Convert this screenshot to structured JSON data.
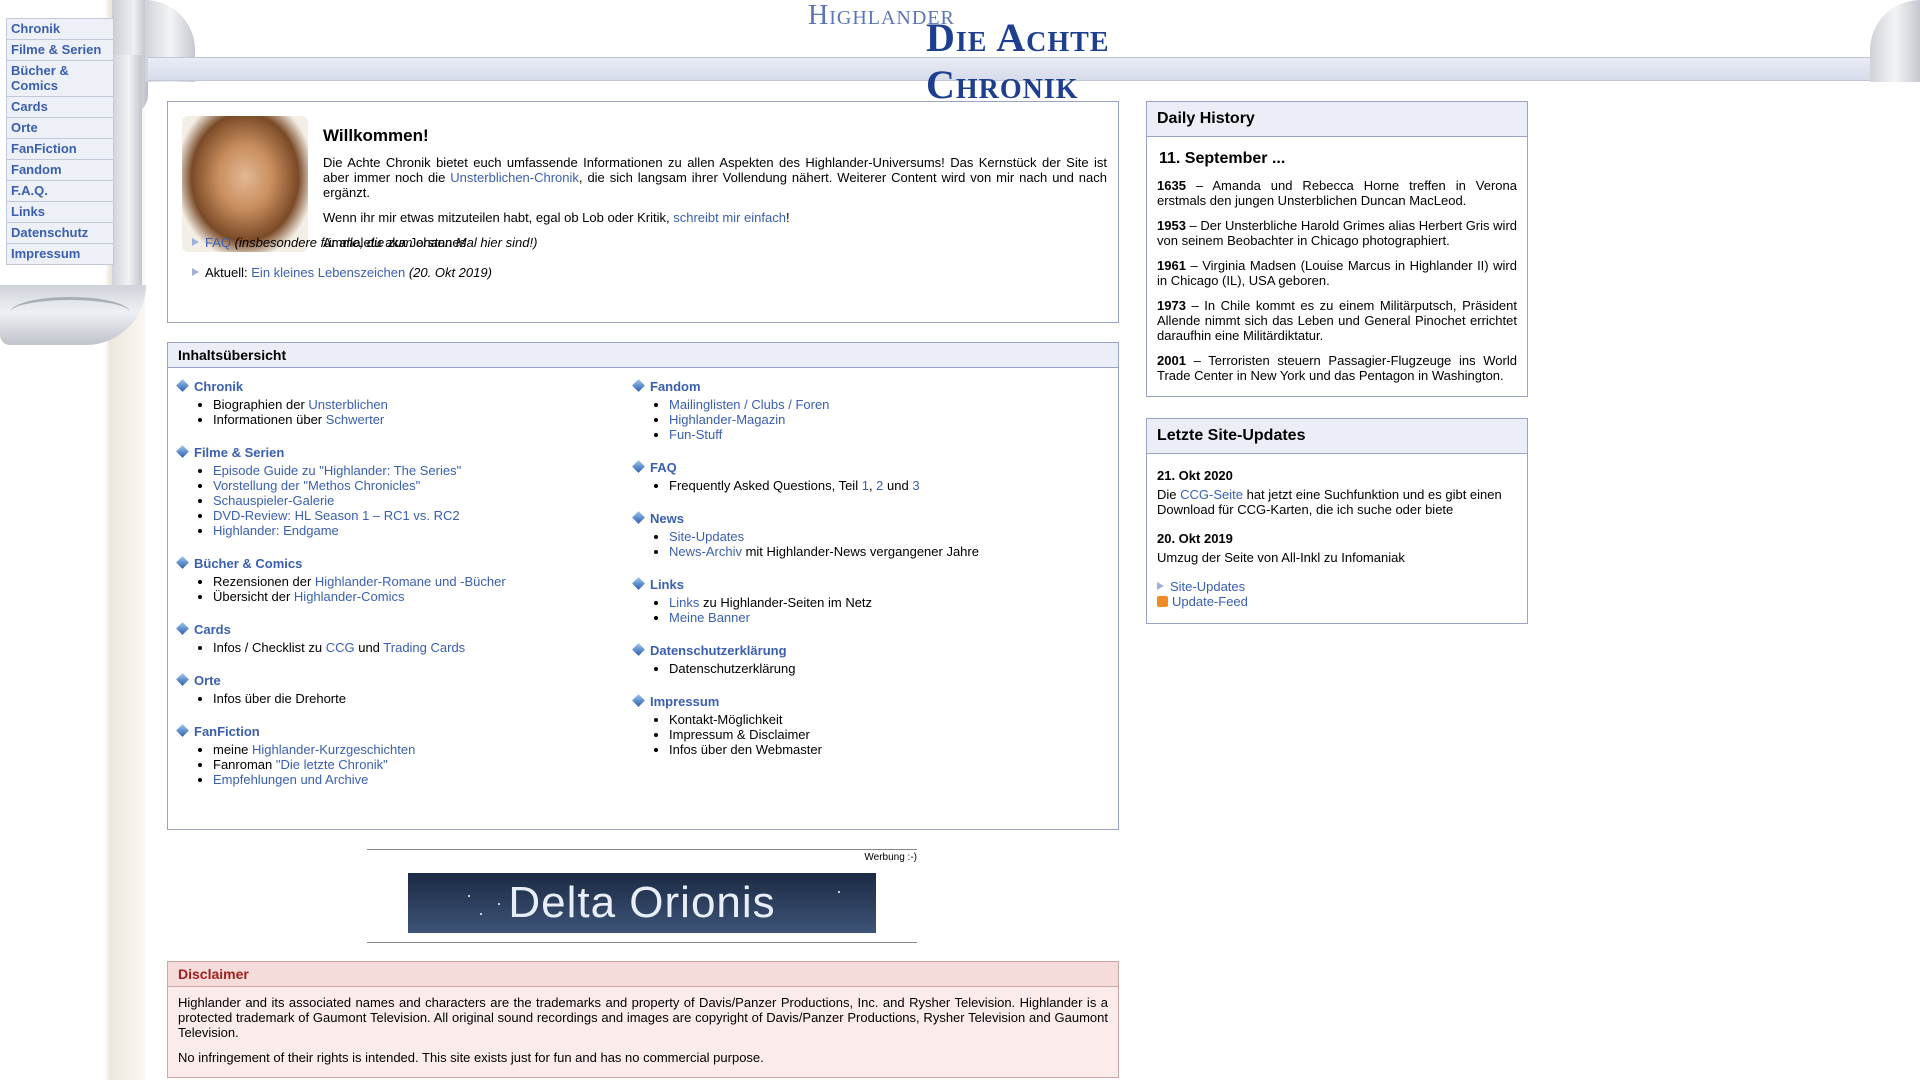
{
  "nav": [
    "Chronik",
    "Filme & Serien",
    "Bücher & Comics",
    "Cards",
    "Orte",
    "FanFiction",
    "Fandom",
    "F.A.Q.",
    "Links",
    "Datenschutz",
    "Impressum"
  ],
  "logo": {
    "line1": "Highlander",
    "line2": "Die Achte Chronik"
  },
  "welcome": {
    "title": "Willkommen!",
    "p1_pre": "Die Achte Chronik bietet euch umfassende Informationen zu allen Aspekten des Highlander-Universums! Das Kernstück der Site ist aber immer noch die ",
    "p1_link": "Unsterblichen-Chronik",
    "p1_post": ", die sich langsam ihrer Vollendung nähert. Weiterer Content wird von mir nach und nach ergänzt.",
    "p2_pre": "Wenn ihr mir etwas mitzuteilen habt, egal ob Lob oder Kritik, ",
    "p2_link": "schreibt mir einfach",
    "p2_post": "!",
    "signature": "Ammaletu aka Johannes",
    "faq_link": "FAQ",
    "faq_note": "(insbesondere für alle, die zum ersten Mal hier sind!)",
    "current_label": "Aktuell:",
    "current_link": "Ein kleines Lebenszeichen",
    "current_date": "(20. Okt 2019)"
  },
  "toc": {
    "title": "Inhaltsübersicht",
    "chronik": {
      "h": "Chronik",
      "i1_pre": "Biographien der ",
      "i1_link": "Unsterblichen",
      "i2_pre": "Informationen über ",
      "i2_link": "Schwerter"
    },
    "filme": {
      "h": "Filme & Serien",
      "items": [
        "Episode Guide zu \"Highlander: The Series\"",
        "Vorstellung der \"Methos Chronicles\"",
        "Schauspieler-Galerie",
        "DVD-Review: HL Season 1 – RC1 vs. RC2",
        "Highlander: Endgame"
      ]
    },
    "buecher": {
      "h": "Bücher & Comics",
      "i1_pre": "Rezensionen der ",
      "i1_link": "Highlander-Romane und -Bücher",
      "i2_pre": "Übersicht der ",
      "i2_link": "Highlander-Comics"
    },
    "cards": {
      "h": "Cards",
      "pre": "Infos / Checklist zu ",
      "link1": "CCG",
      "mid": " und ",
      "link2": "Trading Cards"
    },
    "orte": {
      "h": "Orte",
      "item": "Infos über die Drehorte"
    },
    "fanfiction": {
      "h": "FanFiction",
      "i1_pre": "meine ",
      "i1_link": "Highlander-Kurzgeschichten",
      "i2_pre": "Fanroman ",
      "i2_link": "\"Die letzte Chronik\"",
      "i3_link": "Empfehlungen und Archive"
    },
    "fandom": {
      "h": "Fandom",
      "items": [
        "Mailinglisten / Clubs / Foren",
        "Highlander-Magazin",
        "Fun-Stuff"
      ]
    },
    "faq": {
      "h": "FAQ",
      "pre": "Frequently Asked Questions, Teil ",
      "l1": "1",
      "sep": ", ",
      "l2": "2",
      "und": " und ",
      "l3": "3"
    },
    "news": {
      "h": "News",
      "i1_link": "Site-Updates",
      "i2_link": "News-Archiv",
      "i2_post": " mit Highlander-News vergangener Jahre"
    },
    "links": {
      "h": "Links",
      "i1_link": "Links",
      "i1_post": " zu Highlander-Seiten im Netz",
      "i2_link": "Meine Banner"
    },
    "datenschutz": {
      "h": "Datenschutzerklärung",
      "item": "Datenschutzerklärung"
    },
    "impressum": {
      "h": "Impressum",
      "items": [
        "Kontakt-Möglichkeit",
        "Impressum & Disclaimer",
        "Infos über den Webmaster"
      ]
    }
  },
  "ad": {
    "label": "Werbung :-)",
    "banner": "Delta Orionis"
  },
  "disclaimer": {
    "title": "Disclaimer",
    "p1": "Highlander and its associated names and characters are the trademarks and property of Davis/Panzer Productions, Inc. and Rysher Television. Highlander is a protected trademark of Gaumont Television. All original sound recordings and images are copyright of Davis/Panzer Productions, Rysher Television and Gaumont Television.",
    "p2": "No infringement of their rights is intended. This site exists just for fun and has no commercial purpose."
  },
  "history": {
    "title": "Daily History",
    "date": "11. September ...",
    "items": [
      {
        "year": "1635",
        "text": " – Amanda und Rebecca Horne treffen in Verona erstmals den jungen Unsterblichen Duncan MacLeod."
      },
      {
        "year": "1953",
        "text": " – Der Unsterbliche Harold Grimes alias Herbert Gris wird von seinem Beobachter in Chicago photographiert."
      },
      {
        "year": "1961",
        "text": " – Virginia Madsen (Louise Marcus in Highlander II) wird in Chicago (IL), USA geboren."
      },
      {
        "year": "1973",
        "text": " – In Chile kommt es zu einem Militärputsch, Präsident Allende nimmt sich das Leben und General Pinochet errichtet daraufhin eine Militärdiktatur."
      },
      {
        "year": "2001",
        "text": " – Terroristen steuern Passagier-Flugzeuge ins World Trade Center in New York und das Pentagon in Washington."
      }
    ]
  },
  "updates": {
    "title": "Letzte Site-Updates",
    "u1_date": "21. Okt 2020",
    "u1_pre": "Die ",
    "u1_link": "CCG-Seite",
    "u1_post": " hat jetzt eine Suchfunktion und es gibt einen Download für CCG-Karten, die ich suche oder biete",
    "u2_date": "20. Okt 2019",
    "u2_text": "Umzug der Seite von All-Inkl zu Infomaniak",
    "link_updates": "Site-Updates",
    "link_feed": "Update-Feed"
  }
}
